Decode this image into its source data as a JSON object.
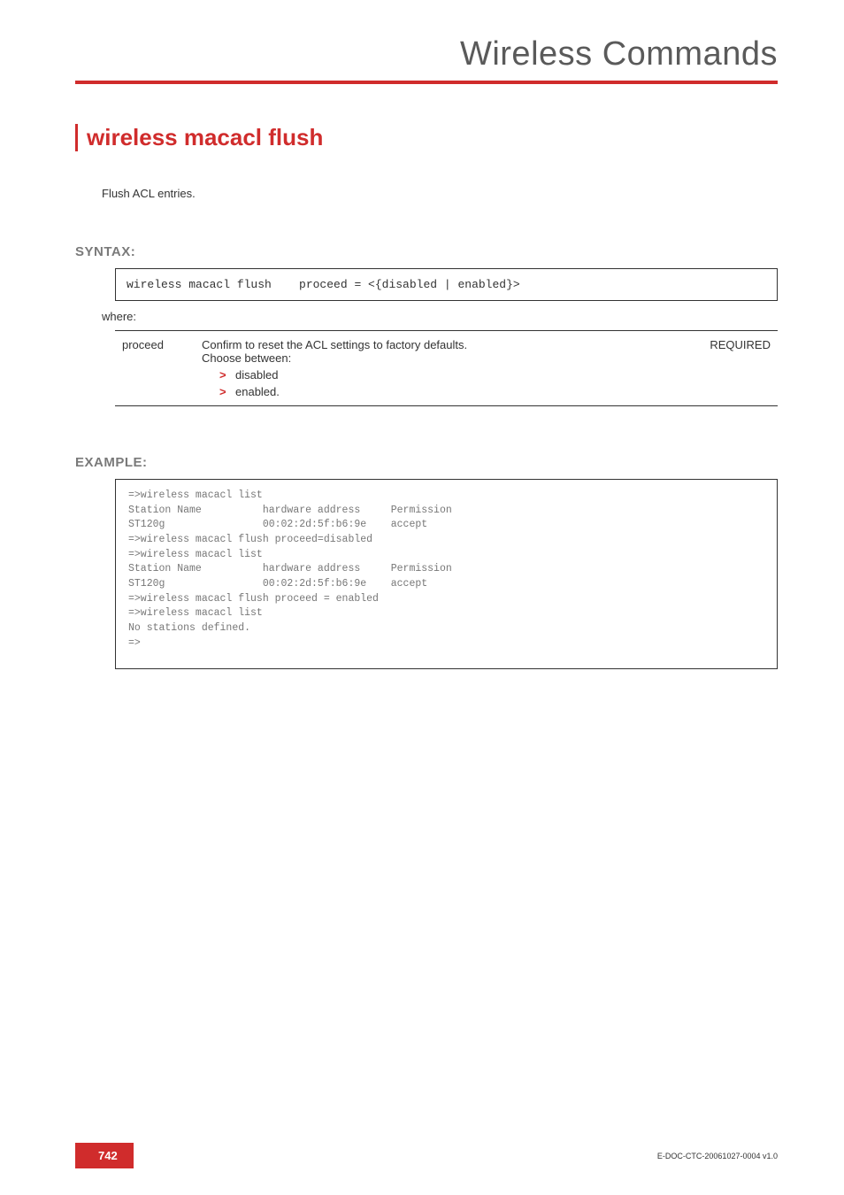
{
  "header": {
    "title": "Wireless Commands"
  },
  "command": {
    "title": "wireless macacl flush",
    "description": "Flush ACL entries."
  },
  "syntax": {
    "heading": "SYNTAX:",
    "code": "wireless macacl flush    proceed = <{disabled | enabled}>",
    "where_label": "where:",
    "params": [
      {
        "name": "proceed",
        "desc_line1": "Confirm to reset the ACL settings to factory defaults.",
        "desc_line2": "Choose between:",
        "options": [
          "disabled",
          "enabled."
        ],
        "required": "REQUIRED"
      }
    ]
  },
  "example": {
    "heading": "EXAMPLE:",
    "code": "=>wireless macacl list\nStation Name          hardware address     Permission\nST120g                00:02:2d:5f:b6:9e    accept\n=>wireless macacl flush proceed=disabled\n=>wireless macacl list\nStation Name          hardware address     Permission\nST120g                00:02:2d:5f:b6:9e    accept\n=>wireless macacl flush proceed = enabled\n=>wireless macacl list\nNo stations defined.\n=>"
  },
  "footer": {
    "page": "742",
    "doc_id": "E-DOC-CTC-20061027-0004 v1.0"
  }
}
